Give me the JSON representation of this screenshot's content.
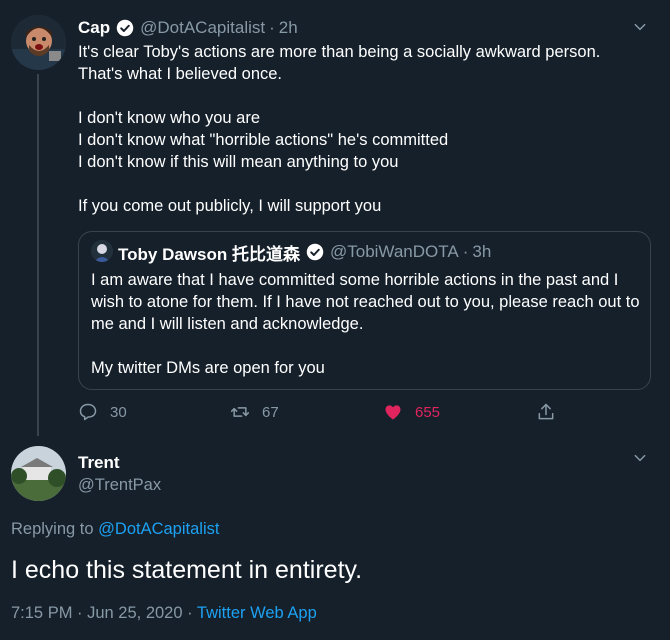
{
  "tweet": {
    "author_name": "Cap",
    "handle": "@DotACapitalist",
    "separator": "·",
    "time": "2h",
    "body": "It's clear Toby's actions are more than being a socially awkward person.\nThat's what I believed once.\n\nI don't know who you are\nI don't know what \"horrible actions\" he's committed\nI don't know if this will mean anything to you\n\nIf you come out publicly, I will support you",
    "quote": {
      "author_name": "Toby Dawson 托比道森",
      "handle": "@TobiWanDOTA",
      "separator": "·",
      "time": "3h",
      "body": "I am aware that I have committed some horrible actions in the past and I wish to atone for them. If I have not reached out to you, please reach out to me and I will listen and acknowledge.\n\nMy twitter DMs are open for you"
    },
    "actions": {
      "replies": "30",
      "retweets": "67",
      "likes": "655"
    }
  },
  "reply": {
    "author_name": "Trent",
    "handle": "@TrentPax",
    "replying_prefix": "Replying to",
    "replying_to": "@DotACapitalist",
    "body": "I echo this statement in entirety.",
    "timestamp": "7:15 PM · Jun 25, 2020 ·",
    "source": "Twitter Web App"
  },
  "icons": {
    "verified": "verified-badge-icon",
    "more": "chevron-down-icon",
    "reply": "reply-icon",
    "retweet": "retweet-icon",
    "like": "heart-filled-icon",
    "share": "share-icon"
  },
  "colors": {
    "background": "#15202b",
    "muted_text": "#8899a6",
    "link_blue": "#1da1f2",
    "like_red": "#e0245e",
    "border": "#38444d"
  }
}
